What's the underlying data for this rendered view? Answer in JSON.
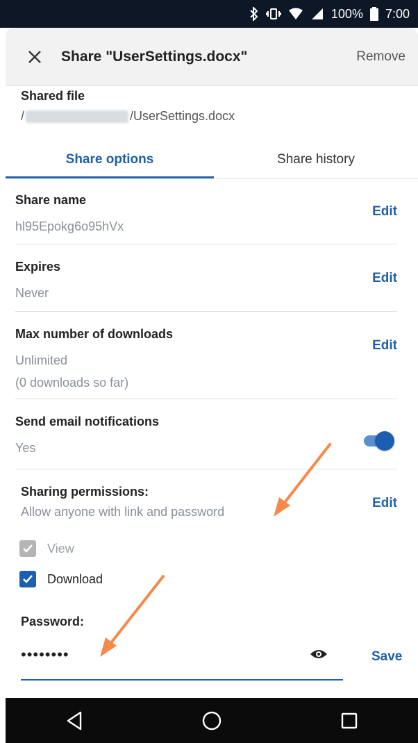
{
  "status": {
    "battery": "100%",
    "time": "7:00"
  },
  "header": {
    "title": "Share \"UserSettings.docx\"",
    "remove_label": "Remove"
  },
  "shared_file": {
    "label": "Shared file",
    "path_prefix": "/",
    "path_suffix": "/UserSettings.docx"
  },
  "tabs": [
    {
      "label": "Share options",
      "active": true
    },
    {
      "label": "Share history",
      "active": false
    }
  ],
  "share_name": {
    "label": "Share name",
    "value": "hl95Epokg6o95hVx",
    "edit_label": "Edit"
  },
  "expires": {
    "label": "Expires",
    "value": "Never",
    "edit_label": "Edit"
  },
  "max_downloads": {
    "label": "Max number of downloads",
    "value": "Unlimited",
    "note": "(0 downloads so far)",
    "edit_label": "Edit"
  },
  "email_notifications": {
    "label": "Send email notifications",
    "value": "Yes",
    "enabled": true
  },
  "sharing_permissions": {
    "label": "Sharing permissions:",
    "value": "Allow anyone with link and password",
    "edit_label": "Edit",
    "options": [
      {
        "label": "View",
        "checked": true,
        "disabled": true
      },
      {
        "label": "Download",
        "checked": true,
        "disabled": false
      }
    ]
  },
  "password": {
    "label": "Password:",
    "value": "••••••••",
    "save_label": "Save"
  },
  "colors": {
    "accent": "#1f5fa8",
    "arrow": "#f58a4b",
    "status_bar": "#0d1726"
  }
}
